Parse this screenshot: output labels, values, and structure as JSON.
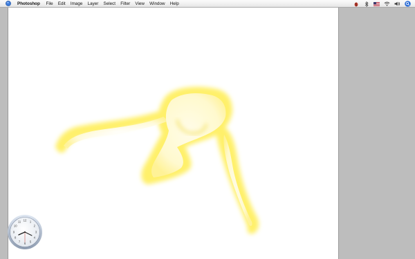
{
  "menubar": {
    "app_name": "Photoshop",
    "items": [
      {
        "id": "file",
        "label": "File"
      },
      {
        "id": "edit",
        "label": "Edit"
      },
      {
        "id": "image",
        "label": "Image"
      },
      {
        "id": "layer",
        "label": "Layer"
      },
      {
        "id": "select",
        "label": "Select"
      },
      {
        "id": "filter",
        "label": "Filter"
      },
      {
        "id": "view",
        "label": "View"
      },
      {
        "id": "window",
        "label": "Window"
      },
      {
        "id": "help",
        "label": "Help"
      }
    ],
    "status_icons": [
      "bug-icon",
      "bluetooth-icon",
      "flag-icon",
      "wifi-icon",
      "volume-icon",
      "spotlight-icon"
    ]
  },
  "colors": {
    "figure_fill": "#fff06a",
    "figure_edge": "#f5e04a",
    "canvas_bg": "#ffffff",
    "desktop_bg": "#bdbdbd",
    "spotlight": "#2f6fd6"
  },
  "clock": {
    "numerals": [
      "12",
      "1",
      "2",
      "3",
      "4",
      "5",
      "6",
      "7",
      "8",
      "9",
      "10",
      "11"
    ]
  }
}
